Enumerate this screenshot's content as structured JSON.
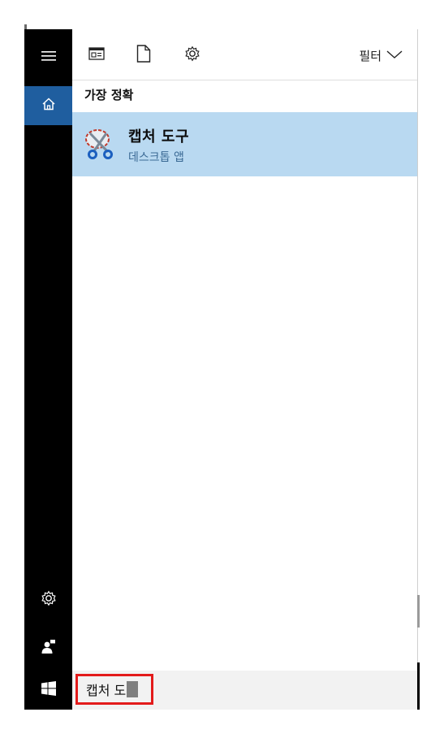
{
  "toolbar": {
    "filter_label": "필터",
    "icons": [
      "news-icon",
      "document-icon",
      "settings-icon"
    ]
  },
  "results": {
    "section_title": "가장 정확",
    "best_match": {
      "title": "캡처 도구",
      "subtitle": "데스크톱 앱",
      "icon": "snipping-tool-icon"
    }
  },
  "search": {
    "query": "캡처 도"
  },
  "rail": {
    "items": [
      "hamburger-menu-icon",
      "home-icon",
      "settings-icon",
      "user-icon",
      "windows-start-icon"
    ]
  },
  "colors": {
    "rail_bg": "#000000",
    "active_blue": "#1f5e9f",
    "selection_blue": "#b9d9f1",
    "highlight_red": "#e31b1b"
  }
}
